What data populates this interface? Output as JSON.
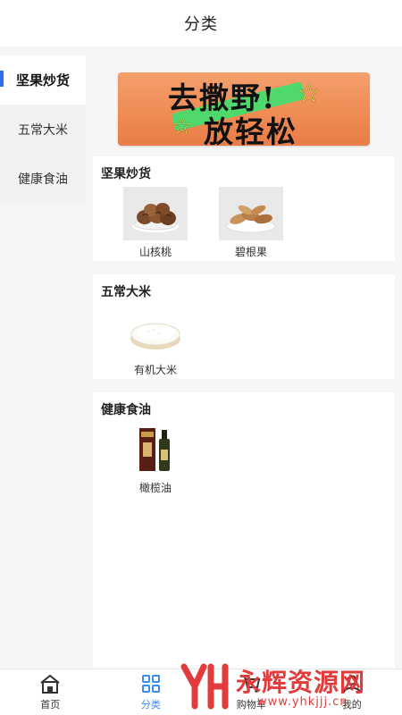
{
  "header": {
    "title": "分类"
  },
  "sidebar": {
    "items": [
      {
        "label": "坚果炒货",
        "active": true
      },
      {
        "label": "五常大米",
        "active": false
      },
      {
        "label": "健康食油",
        "active": false
      }
    ]
  },
  "banner": {
    "line1": "去撒野!",
    "line2": "放轻松"
  },
  "sections": [
    {
      "title": "坚果炒货",
      "products": [
        {
          "name": "山核桃",
          "icon": "pecans-image"
        },
        {
          "name": "碧根果",
          "icon": "brazil-nuts-image"
        }
      ]
    },
    {
      "title": "五常大米",
      "products": [
        {
          "name": "有机大米",
          "icon": "rice-bowl-image"
        }
      ]
    },
    {
      "title": "健康食油",
      "products": [
        {
          "name": "橄榄油",
          "icon": "olive-oil-image"
        }
      ]
    }
  ],
  "tabbar": {
    "items": [
      {
        "label": "首页",
        "icon": "home-icon",
        "active": false
      },
      {
        "label": "分类",
        "icon": "category-grid-icon",
        "active": true
      },
      {
        "label": "购物车",
        "icon": "cart-icon",
        "active": false
      },
      {
        "label": "我的",
        "icon": "user-icon",
        "active": false
      }
    ]
  },
  "watermark": {
    "text": "永辉资源网",
    "url": "www.yhkjjj.cn"
  },
  "colors": {
    "accent": "#2e6ff2",
    "tab_active": "#3b8cf0",
    "banner": "#ef8a52"
  }
}
